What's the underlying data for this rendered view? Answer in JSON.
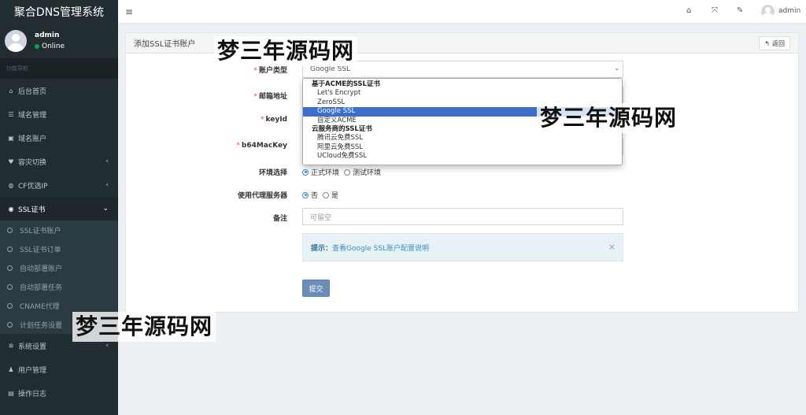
{
  "sidebar": {
    "brand": "聚合DNS管理系统",
    "user_name": "admin",
    "user_status": "Online",
    "nav_header": "功能导航",
    "items": [
      {
        "label": "后台首页",
        "icon": "home-icon",
        "glyph": "⌂"
      },
      {
        "label": "域名管理",
        "icon": "list-icon",
        "glyph": "☰"
      },
      {
        "label": "域名账户",
        "icon": "lock-icon",
        "glyph": "▣"
      },
      {
        "label": "容灾切换",
        "icon": "heartbeat-icon",
        "glyph": "♥"
      },
      {
        "label": "CF优选IP",
        "icon": "globe-icon",
        "glyph": "◍"
      },
      {
        "label": "SSL证书",
        "icon": "shield-icon",
        "glyph": "◉"
      }
    ],
    "submenu": [
      "SSL证书账户",
      "SSL证书订单",
      "自动部署账户",
      "自动部署任务",
      "CNAME代理",
      "计划任务设置"
    ],
    "bottom_items": [
      {
        "label": "系统设置",
        "icon": "gears-icon",
        "glyph": "✲"
      },
      {
        "label": "用户管理",
        "icon": "user-icon",
        "glyph": "♟"
      },
      {
        "label": "操作日志",
        "icon": "log-icon",
        "glyph": "▤"
      }
    ]
  },
  "topbar": {
    "user_name": "admin",
    "menu_glyph": "≡",
    "home_glyph": "⌂",
    "fullscreen_glyph": "⤧",
    "wrench_glyph": "✎"
  },
  "panel": {
    "title": "添加SSL证书账户",
    "back_label": "返回",
    "back_glyph": "↰"
  },
  "form": {
    "account_type_label": "账户类型",
    "account_type_value": "Google SSL",
    "email_label": "邮箱地址",
    "keyid_label": "keyId",
    "b64_label": "b64MacKey",
    "env_label": "环境选择",
    "env_options": [
      "正式环境",
      "测试环境"
    ],
    "proxy_label": "使用代理服务器",
    "proxy_options": [
      "否",
      "是"
    ],
    "remark_label": "备注",
    "remark_placeholder": "可留空",
    "hint_title": "提示：",
    "hint_link": "查看Google SSL账户配置说明",
    "submit_label": "提交",
    "required_mark": "*"
  },
  "dropdown": {
    "group1": "基于ACME的SSL证书",
    "group1_options": [
      "Let's Encrypt",
      "ZeroSSL",
      "Google SSL",
      "自定义ACME"
    ],
    "group2": "云服务商的SSL证书",
    "group2_options": [
      "腾讯云免费SSL",
      "阿里云免费SSL",
      "UCloud免费SSL"
    ],
    "selected": "Google SSL"
  },
  "watermark": "梦三年源码网",
  "colors": {
    "sidebar_bg": "#222d32",
    "accent": "#3c8dbc",
    "online": "#00a65a",
    "selected_option": "#3c6fc9"
  }
}
